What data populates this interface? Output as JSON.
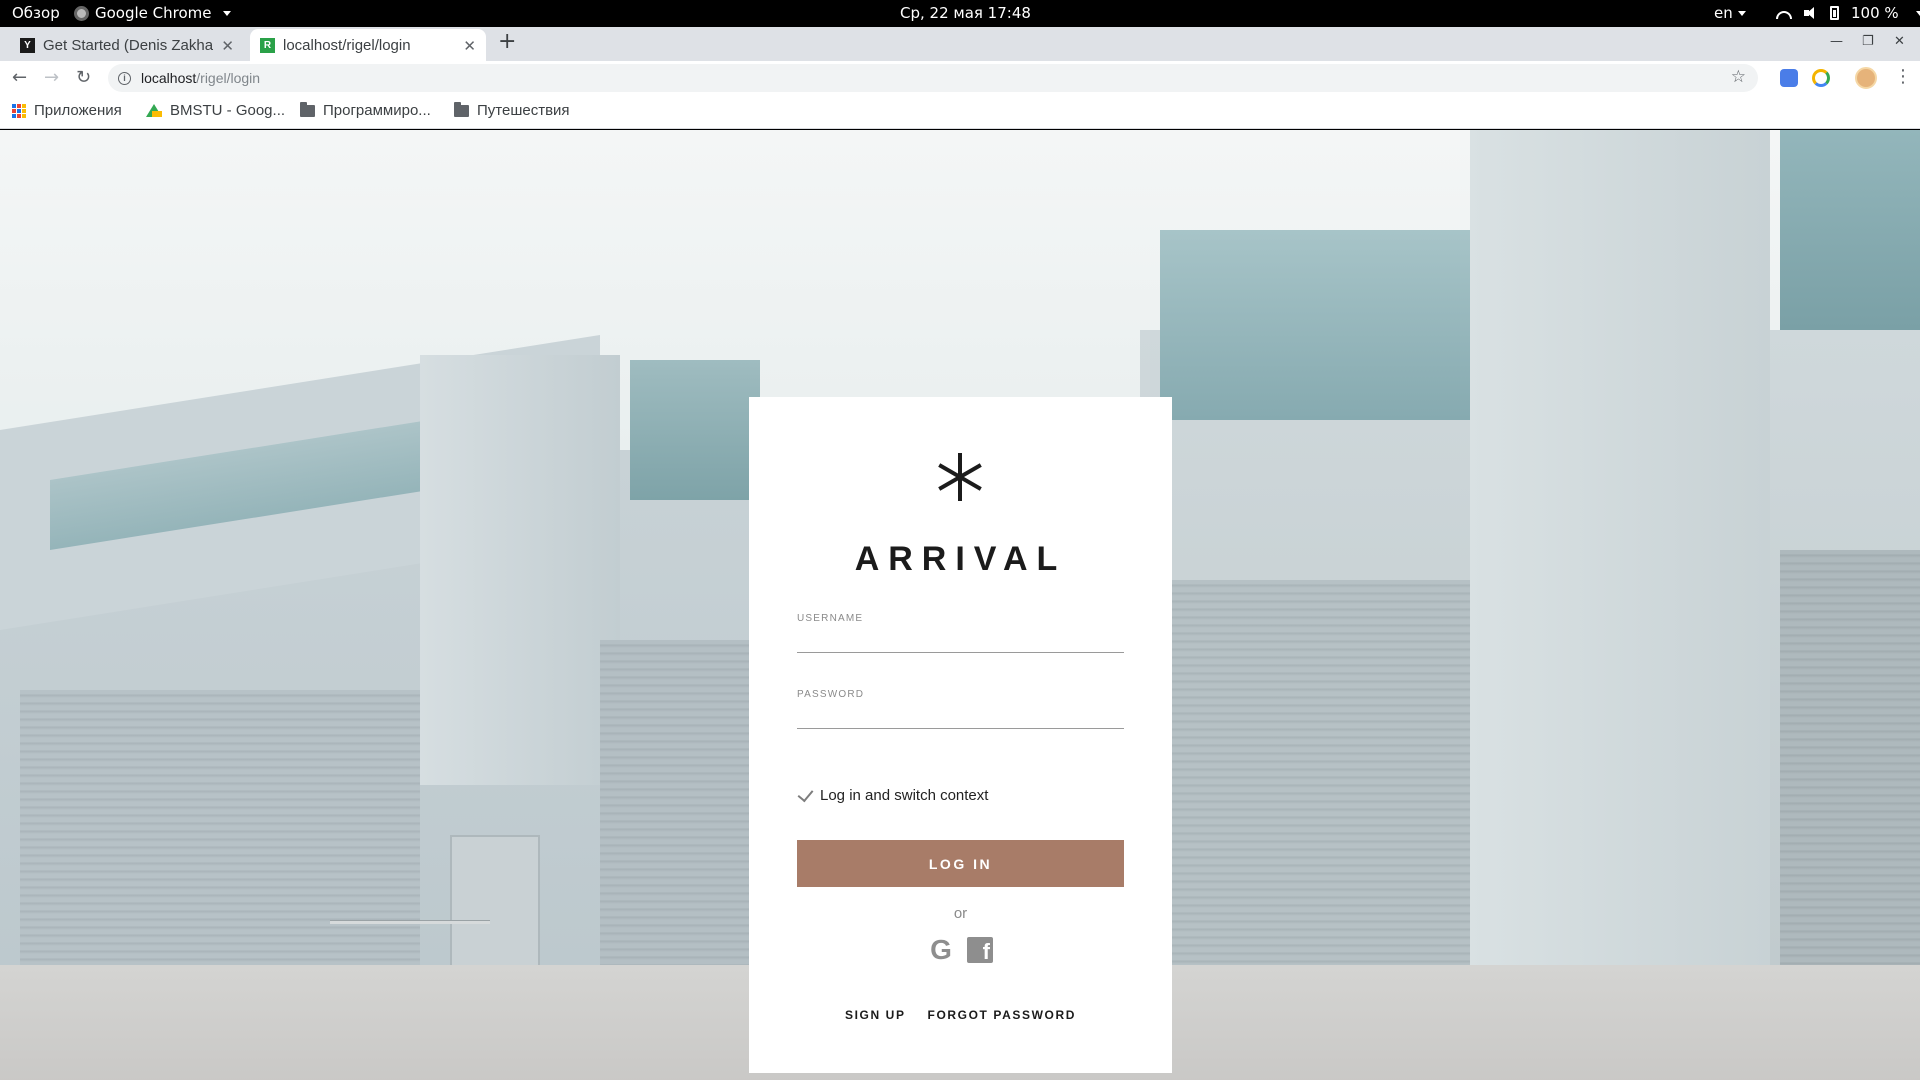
{
  "system_bar": {
    "overview": "Обзор",
    "app_name": "Google Chrome",
    "clock": "Ср, 22 мая  17:48",
    "language": "en",
    "battery": "100 %"
  },
  "browser": {
    "tabs": [
      {
        "title": "Get Started (Denis Zakharov)",
        "favicon": "jetbrains-icon",
        "active": false
      },
      {
        "title": "localhost/rigel/login",
        "favicon": "r-icon",
        "active": true
      }
    ],
    "new_tab": "+",
    "address": {
      "host": "localhost",
      "path": "/rigel/login"
    },
    "bookmarks": [
      {
        "label": "Приложения",
        "icon": "apps-grid-icon"
      },
      {
        "label": "BMSTU - Goog...",
        "icon": "drive-icon"
      },
      {
        "label": "Программиро...",
        "icon": "folder-icon"
      },
      {
        "label": "Путешествия",
        "icon": "folder-icon"
      }
    ]
  },
  "login": {
    "brand": "ARRIVAL",
    "logo_icon": "asterisk-logo-icon",
    "username_label": "USERNAME",
    "username_value": "",
    "password_label": "PASSWORD",
    "password_value": "",
    "switch_context": "Log in and switch context",
    "submit": "LOG IN",
    "or": "or",
    "social": {
      "google": "G",
      "facebook": "f"
    },
    "sign_up": "SIGN UP",
    "forgot_password": "FORGOT PASSWORD",
    "colors": {
      "button": "#a87c68",
      "card": "#ffffff",
      "text": "#1b1b1b"
    }
  }
}
